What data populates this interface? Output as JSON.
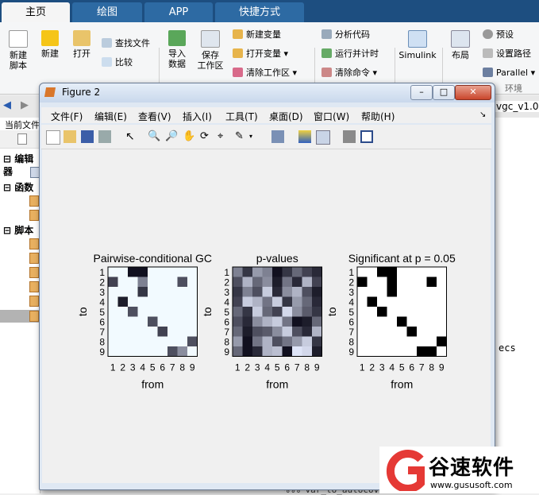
{
  "ribbon": {
    "tabs": [
      "主页",
      "绘图",
      "APP",
      "快捷方式"
    ],
    "new_script": [
      "新建",
      "脚本"
    ],
    "new": "新建",
    "open": "打开",
    "find_files": "查找文件",
    "compare": "比较",
    "import_data": [
      "导入",
      "数据"
    ],
    "save_workspace": [
      "保存",
      "工作区"
    ],
    "new_variable": "新建变量",
    "open_variable": "打开变量",
    "clear_workspace": "清除工作区",
    "analyze_code": "分析代码",
    "run_and_time": "运行并计时",
    "clear_commands": "清除命令",
    "simulink": "Simulink",
    "layout": "布局",
    "preferences": "预设",
    "set_path": "设置路径",
    "parallel": "Parallel",
    "environment": "环境"
  },
  "background": {
    "current_folder": "当前文件",
    "sections": [
      "编辑器",
      "函数",
      "脚本"
    ],
    "editor_tab": "vgc_v1.0",
    "code_fragment": "ecs",
    "code_line": "%%% var_to_autocov..."
  },
  "figure": {
    "title": "Figure 2",
    "menu": [
      "文件(F)",
      "编辑(E)",
      "查看(V)",
      "插入(I)",
      "工具(T)",
      "桌面(D)",
      "窗口(W)",
      "帮助(H)"
    ],
    "buttons": {
      "minimize": "–",
      "maximize": "□",
      "close": "✕"
    }
  },
  "chart_data": [
    {
      "type": "heatmap",
      "title": "Pairwise-conditional GC",
      "xlabel": "from",
      "ylabel": "to",
      "xticks": [
        "1",
        "2",
        "3",
        "4",
        "5",
        "6",
        "7",
        "8",
        "9"
      ],
      "yticks": [
        "1",
        "2",
        "3",
        "4",
        "5",
        "6",
        "7",
        "8",
        "9"
      ],
      "colormap": "gray-reversed",
      "values": [
        [
          0,
          0,
          0.95,
          0.95,
          0,
          0,
          0,
          0,
          0
        ],
        [
          0.75,
          0,
          0,
          0.5,
          0,
          0,
          0,
          0.7,
          0
        ],
        [
          0,
          0,
          0,
          0.8,
          0,
          0,
          0,
          0,
          0
        ],
        [
          0,
          0.9,
          0,
          0,
          0,
          0,
          0,
          0,
          0
        ],
        [
          0,
          0,
          0.7,
          0,
          0,
          0,
          0,
          0,
          0
        ],
        [
          0,
          0,
          0,
          0,
          0.7,
          0,
          0,
          0,
          0
        ],
        [
          0,
          0,
          0,
          0,
          0,
          0.75,
          0,
          0,
          0
        ],
        [
          0,
          0,
          0,
          0,
          0,
          0,
          0,
          0,
          0.7
        ],
        [
          0,
          0,
          0,
          0,
          0,
          0,
          0.7,
          0.45,
          0
        ]
      ]
    },
    {
      "type": "heatmap",
      "title": "p-values",
      "xlabel": "from",
      "ylabel": "to",
      "xticks": [
        "1",
        "2",
        "3",
        "4",
        "5",
        "6",
        "7",
        "8",
        "9"
      ],
      "yticks": [
        "1",
        "2",
        "3",
        "4",
        "5",
        "6",
        "7",
        "8",
        "9"
      ],
      "colormap": "gray-reversed",
      "values": [
        [
          0.5,
          0.8,
          0.4,
          0.5,
          0.95,
          0.8,
          0.6,
          0.75,
          0.85
        ],
        [
          0.7,
          0.3,
          0.6,
          0.45,
          0.9,
          0.55,
          0.85,
          0.3,
          0.75
        ],
        [
          0.8,
          0.5,
          0.7,
          0.2,
          0.85,
          0.45,
          0.3,
          0.7,
          0.9
        ],
        [
          0.75,
          0.2,
          0.3,
          0.55,
          0.2,
          0.8,
          0.4,
          0.6,
          0.85
        ],
        [
          0.6,
          0.8,
          0.2,
          0.6,
          0.75,
          0.15,
          0.45,
          0.65,
          0.8
        ],
        [
          0.7,
          0.85,
          0.45,
          0.3,
          0.2,
          0.55,
          0.95,
          0.9,
          0.6
        ],
        [
          0.6,
          0.9,
          0.7,
          0.65,
          0.45,
          0.2,
          0.7,
          0.85,
          0.3
        ],
        [
          0.4,
          0.95,
          0.55,
          0.3,
          0.7,
          0.55,
          0.4,
          0.2,
          0.8
        ],
        [
          0.6,
          0.95,
          0.85,
          0.3,
          0.25,
          0.95,
          0.1,
          0.15,
          0.9
        ]
      ]
    },
    {
      "type": "heatmap",
      "title": "Significant at p = 0.05",
      "xlabel": "from",
      "ylabel": "to",
      "xticks": [
        "1",
        "2",
        "3",
        "4",
        "5",
        "6",
        "7",
        "8",
        "9"
      ],
      "yticks": [
        "1",
        "2",
        "3",
        "4",
        "5",
        "6",
        "7",
        "8",
        "9"
      ],
      "colormap": "binary",
      "values": [
        [
          0,
          0,
          1,
          1,
          0,
          0,
          0,
          0,
          0
        ],
        [
          1,
          0,
          0,
          1,
          0,
          0,
          0,
          1,
          0
        ],
        [
          0,
          0,
          0,
          1,
          0,
          0,
          0,
          0,
          0
        ],
        [
          0,
          1,
          0,
          0,
          0,
          0,
          0,
          0,
          0
        ],
        [
          0,
          0,
          1,
          0,
          0,
          0,
          0,
          0,
          0
        ],
        [
          0,
          0,
          0,
          0,
          1,
          0,
          0,
          0,
          0
        ],
        [
          0,
          0,
          0,
          0,
          0,
          1,
          0,
          0,
          0
        ],
        [
          0,
          0,
          0,
          0,
          0,
          0,
          0,
          0,
          1
        ],
        [
          0,
          0,
          0,
          0,
          0,
          0,
          1,
          1,
          0
        ]
      ]
    }
  ],
  "watermark": {
    "brand": "谷速软件",
    "url": "www.gususoft.com"
  },
  "colors": {
    "ribbon_tab_bar": "#1d4e80",
    "figure_frame": "#dfe8f3",
    "canvas": "#f0f0f0"
  }
}
